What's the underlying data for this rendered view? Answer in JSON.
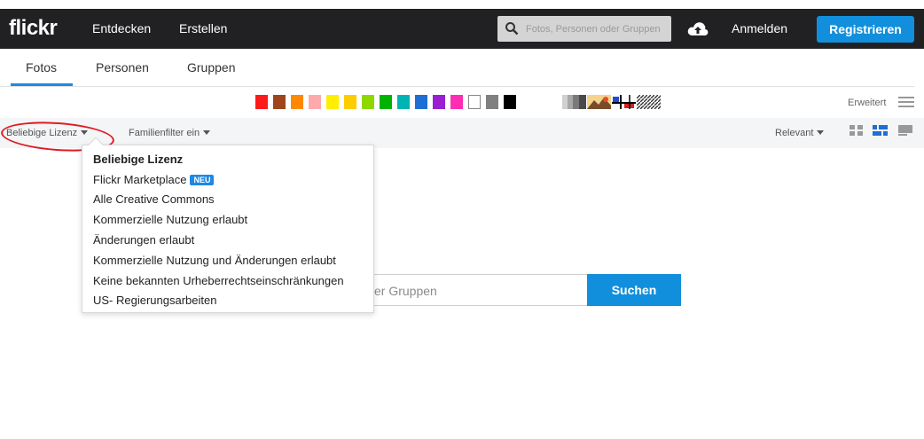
{
  "header": {
    "logo": "flickr",
    "nav": [
      "Entdecken",
      "Erstellen"
    ],
    "search_placeholder": "Fotos, Personen oder Gruppen",
    "login": "Anmelden",
    "register": "Registrieren",
    "colors": {
      "bar": "#212124",
      "accent": "#128fdc"
    }
  },
  "tabs": [
    "Fotos",
    "Personen",
    "Gruppen"
  ],
  "color_filters": [
    "#ff1a1a",
    "#a0441e",
    "#ff8800",
    "#ffaaaa",
    "#ffee00",
    "#ffcc00",
    "#8ed800",
    "#00b300",
    "#00b4b4",
    "#1f6ed4",
    "#9a1fd1",
    "#ff2db4",
    "#ffffff",
    "#808080",
    "#000000"
  ],
  "pattern_filters": [
    "black-white-icon",
    "shallow-depth-icon",
    "minimalist-icon",
    "pattern-icon"
  ],
  "advanced_label": "Erweitert",
  "filters": {
    "license": "Beliebige Lizenz",
    "family": "Familienfilter ein",
    "sort": "Relevant"
  },
  "license_menu": {
    "items": [
      "Beliebige Lizenz",
      "Flickr Marketplace",
      "Alle Creative Commons",
      "Kommerzielle Nutzung erlaubt",
      "Änderungen erlaubt",
      "Kommerzielle Nutzung und Änderungen erlaubt",
      "Keine bekannten Urheberrechtseinschränkungen",
      "US- Regierungsarbeiten"
    ],
    "badge": "NEU"
  },
  "main_search": {
    "placeholder_visible": "er Gruppen",
    "button": "Suchen"
  },
  "highlight_color": "#e01b24"
}
